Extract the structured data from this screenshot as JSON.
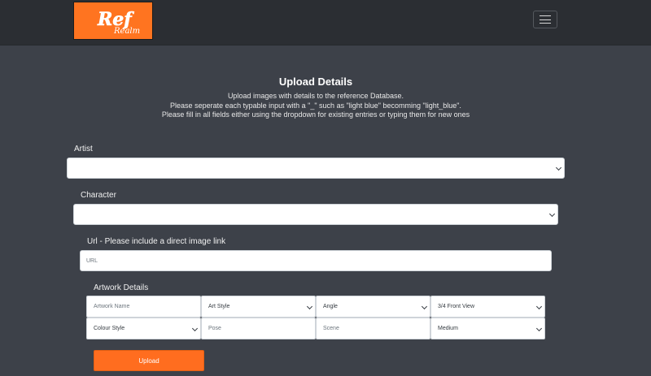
{
  "navbar": {
    "logo_line1": "Ref",
    "logo_line2": "Realm",
    "logo_color": "#ff7420"
  },
  "form": {
    "heading": "Upload Details",
    "instructions": [
      "Upload images with details to the reference Database.",
      "Please seperate each typable input with a \"_\" such as \"light blue\" becomming \"light_blue\".",
      "Please fill in all fields either using the dropdown for existing entries or typing them for new ones"
    ],
    "artist_label": "Artist",
    "artist_value": "",
    "character_label": "Character",
    "character_value": "",
    "url_label": "Url - Please include a direct image link",
    "url_placeholder": "URL",
    "details_label": "Artwork Details",
    "details": {
      "artwork_name_placeholder": "Artwork Name",
      "art_style": "Art Style",
      "angle": "Angle",
      "view": "3/4 Front View",
      "colour_style": "Colour Style",
      "pose_placeholder": "Pose",
      "scene_placeholder": "Scene",
      "quality": "Medium"
    },
    "upload_label": "Upload",
    "accent_color": "#ff6d1f"
  }
}
